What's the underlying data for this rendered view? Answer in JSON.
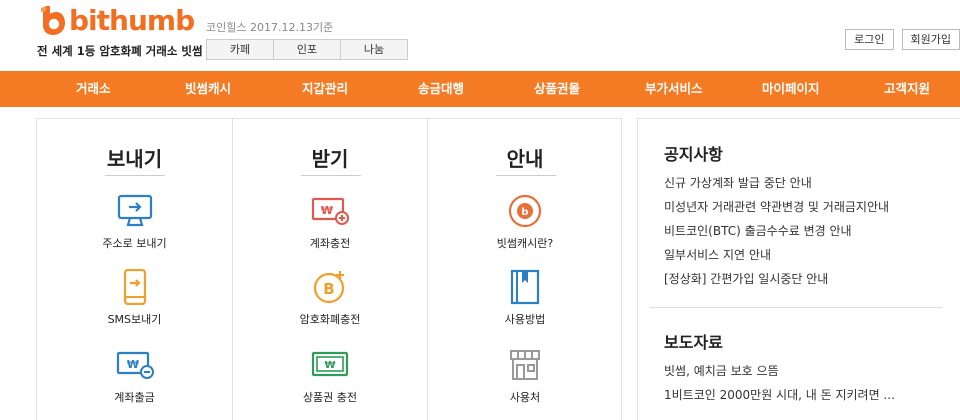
{
  "header": {
    "logo_text": "bithumb",
    "coinhills": "코인힐스 2017.12.13기준",
    "slogan": "전 세계 1등 암호화폐 거래소 빗썸",
    "community_tabs": [
      "카페",
      "인포",
      "나눔"
    ],
    "top_links": [
      "로그인",
      "회원가입"
    ],
    "brand_color": "#f26f21"
  },
  "nav": {
    "color": "#f47b24",
    "items": [
      "거래소",
      "빗썸캐시",
      "지갑관리",
      "송금대행",
      "상품권몰",
      "부가서비스",
      "마이페이지",
      "고객지원"
    ]
  },
  "columns": [
    {
      "title": "보내기",
      "items": [
        {
          "label": "주소로 보내기",
          "icon": "monitor-send-icon"
        },
        {
          "label": "SMS보내기",
          "icon": "mobile-send-icon"
        },
        {
          "label": "계좌출금",
          "icon": "bank-withdraw-icon"
        }
      ]
    },
    {
      "title": "받기",
      "items": [
        {
          "label": "계좌충전",
          "icon": "won-card-plus-icon"
        },
        {
          "label": "암호화폐충전",
          "icon": "bitcoin-plus-icon"
        },
        {
          "label": "상품권 충전",
          "icon": "voucher-icon"
        }
      ]
    },
    {
      "title": "안내",
      "items": [
        {
          "label": "빗썸캐시란?",
          "icon": "cash-coin-icon"
        },
        {
          "label": "사용방법",
          "icon": "book-icon"
        },
        {
          "label": "사용처",
          "icon": "store-icon"
        }
      ]
    }
  ],
  "notices": {
    "title": "공지사항",
    "items": [
      "신규 가상계좌 발급 중단 안내",
      "미성년자 거래관련 약관변경 및 거래금지안내",
      "비트코인(BTC) 출금수수료 변경 안내",
      "일부서비스 지연 안내",
      "[정상화] 간편가입 일시중단 안내"
    ]
  },
  "press": {
    "title": "보도자료",
    "items": [
      "빗썸, 예치금 보호 으뜸",
      "1비트코인 2000만원 시대, 내 돈 지키려면 ..."
    ]
  }
}
